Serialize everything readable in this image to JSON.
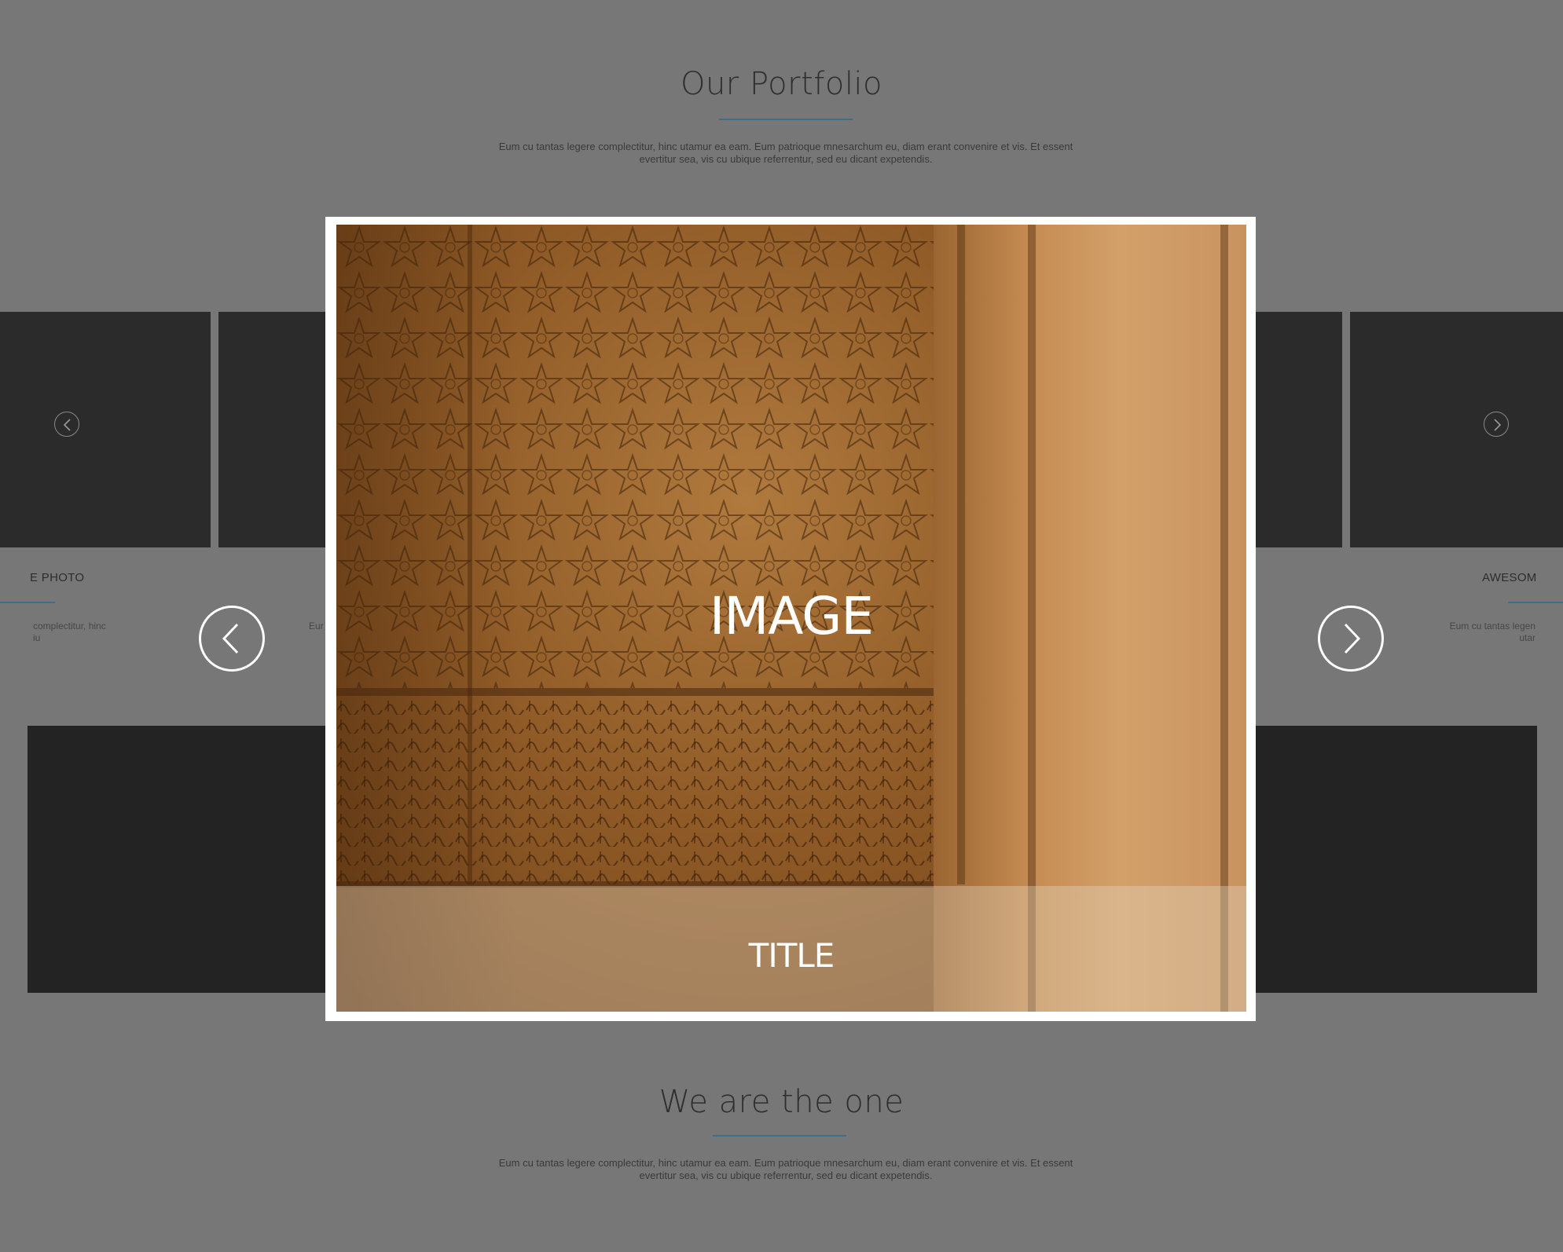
{
  "portfolio": {
    "heading": "Our Portfolio",
    "description_line1": "Eum cu tantas legere complectitur, hinc utamur ea eam. Eum patrioque mnesarchum eu, diam erant convenire et vis. Et essent",
    "description_line2": "evertitur sea, vis cu ubique referrentur, sed eu dicant expetendis."
  },
  "tiles": {
    "left_caption": "E PHOTO",
    "left_text_line1": "complectitur, hinc",
    "left_text_line2": "iu",
    "mid_text": "Eur",
    "right_caption": "AWESOM",
    "right_text_line1": "Eum cu tantas legen",
    "right_text_line2": "utar"
  },
  "lightbox": {
    "image_label": "IMAGE",
    "title_label": "TITLE",
    "prev_icon": "chevron-left-icon",
    "next_icon": "chevron-right-icon"
  },
  "about": {
    "heading": "We are the one",
    "description_line1": "Eum cu tantas legere complectitur, hinc utamur ea eam. Eum patrioque mnesarchum eu, diam erant convenire et vis. Et essent",
    "description_line2": "evertitur sea, vis cu ubique referrentur, sed eu dicant expetendis."
  },
  "colors": {
    "overlay": "#777777",
    "tile": "#2b2b2b",
    "accent_rule": "#3f6e86",
    "lightbox_frame": "#ffffff"
  }
}
